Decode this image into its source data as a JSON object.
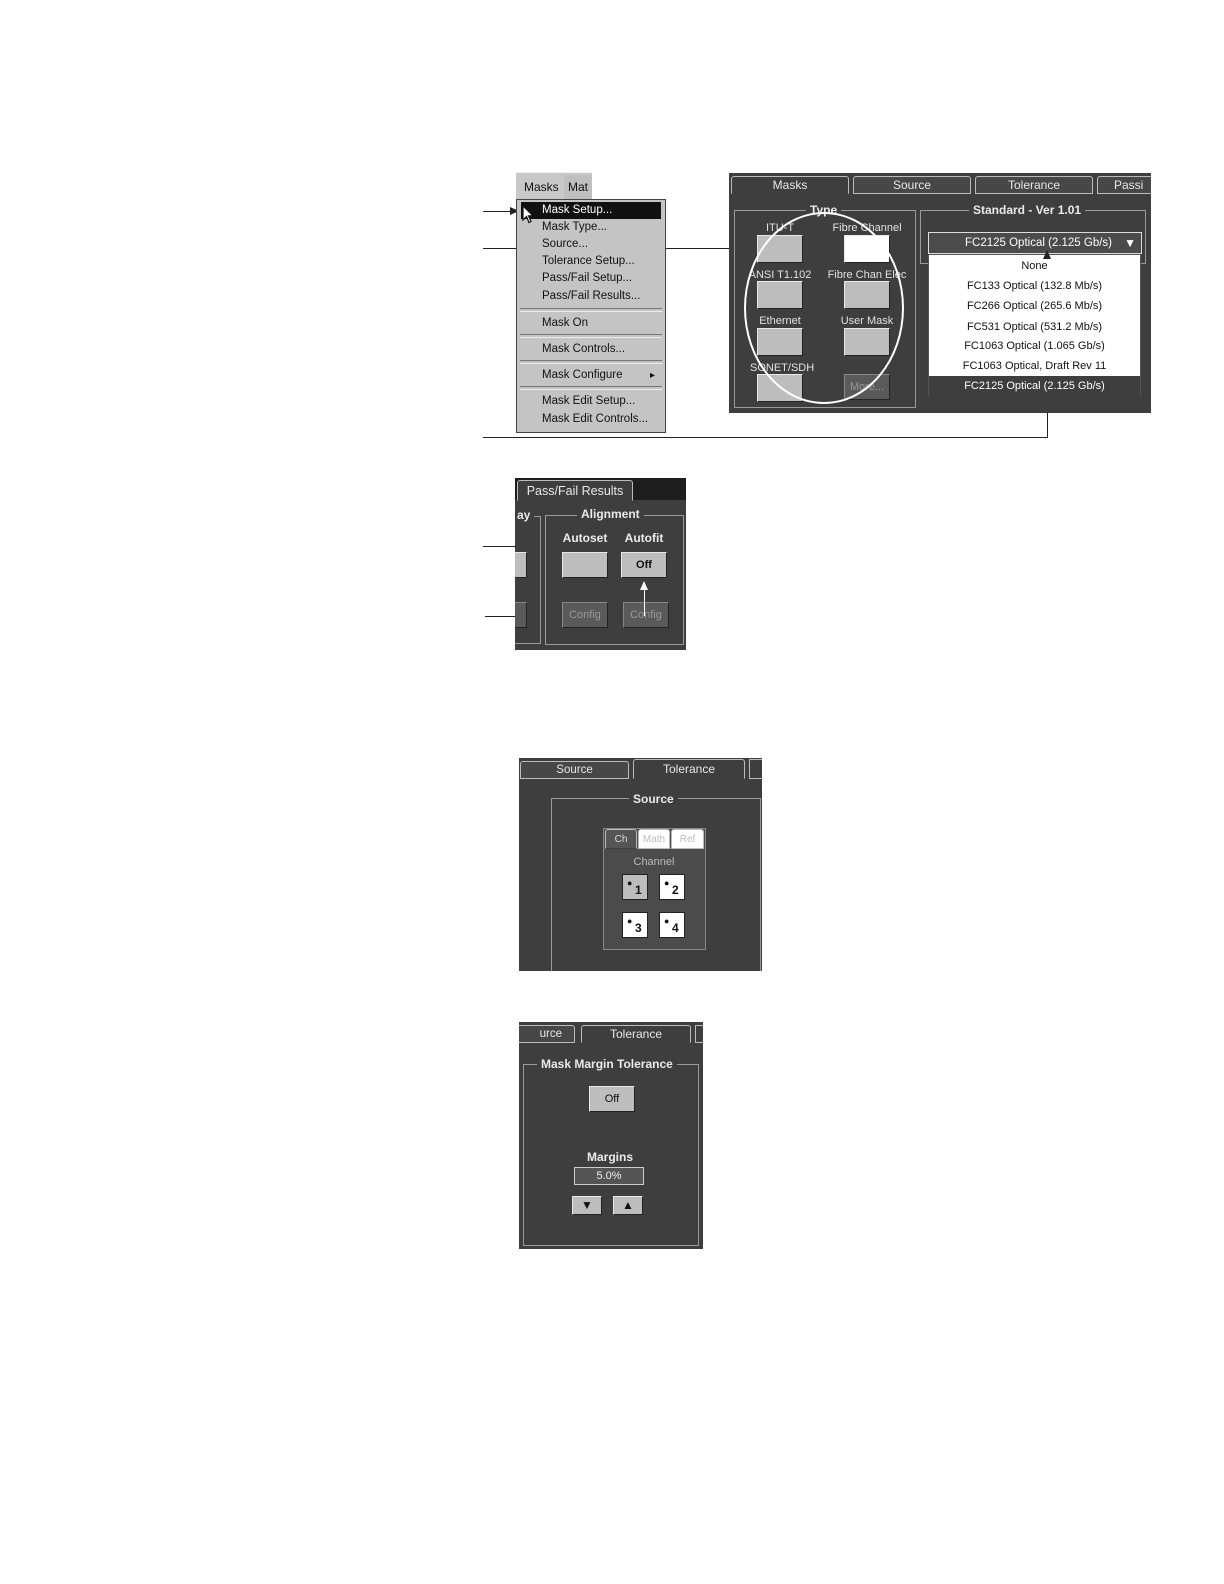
{
  "menu": {
    "bar": [
      "Masks",
      "Mat"
    ],
    "items": [
      {
        "label": "Mask Setup...",
        "selected": true
      },
      {
        "label": "Mask Type..."
      },
      {
        "label": "Source..."
      },
      {
        "label": "Tolerance Setup..."
      },
      {
        "label": "Pass/Fail Setup..."
      },
      {
        "label": "Pass/Fail Results..."
      },
      {
        "label": "Mask On"
      },
      {
        "label": "Mask Controls..."
      },
      {
        "label": "Mask Configure",
        "submenu_glyph": "▸"
      },
      {
        "label": "Mask Edit Setup..."
      },
      {
        "label": "Mask Edit Controls..."
      }
    ]
  },
  "masks_panel": {
    "tabs": [
      "Masks",
      "Source",
      "Tolerance",
      "Passi"
    ],
    "type_group": "Type",
    "types": [
      "ITU-T",
      "Fibre Channel",
      "ANSI T1.102",
      "Fibre Chan Elec",
      "Ethernet",
      "User Mask",
      "SONET/SDH"
    ],
    "more_button": "More...",
    "standard_group": "Standard - Ver 1.01",
    "standard_value": "FC2125 Optical (2.125 Gb/s)",
    "dropdown_arrow": "▼",
    "options": [
      "None",
      "FC133 Optical (132.8 Mb/s)",
      "FC266 Optical (265.6 Mb/s)",
      "FC531 Optical (531.2 Mb/s)",
      "FC1063 Optical (1.065 Gb/s)",
      "FC1063 Optical, Draft Rev 11",
      "FC2125 Optical (2.125 Gb/s)"
    ]
  },
  "passfail_panel": {
    "tab": "Pass/Fail Results",
    "partial_label": "ay",
    "alignment_group": "Alignment",
    "autoset_label": "Autoset",
    "autofit_label": "Autofit",
    "autofit_button": "Off",
    "config_label": "Config"
  },
  "source_panel": {
    "tabs": [
      "Source",
      "Tolerance"
    ],
    "group": "Source",
    "subtabs": [
      "Ch",
      "Math",
      "Ref"
    ],
    "channel_label": "Channel",
    "channels": [
      "1",
      "2",
      "3",
      "4"
    ]
  },
  "tolerance_panel": {
    "tabs": [
      "urce",
      "Tolerance"
    ],
    "group": "Mask Margin Tolerance",
    "toggle": "Off",
    "margins_label": "Margins",
    "margins_value": "5.0%",
    "down_glyph": "▼",
    "up_glyph": "▲"
  }
}
